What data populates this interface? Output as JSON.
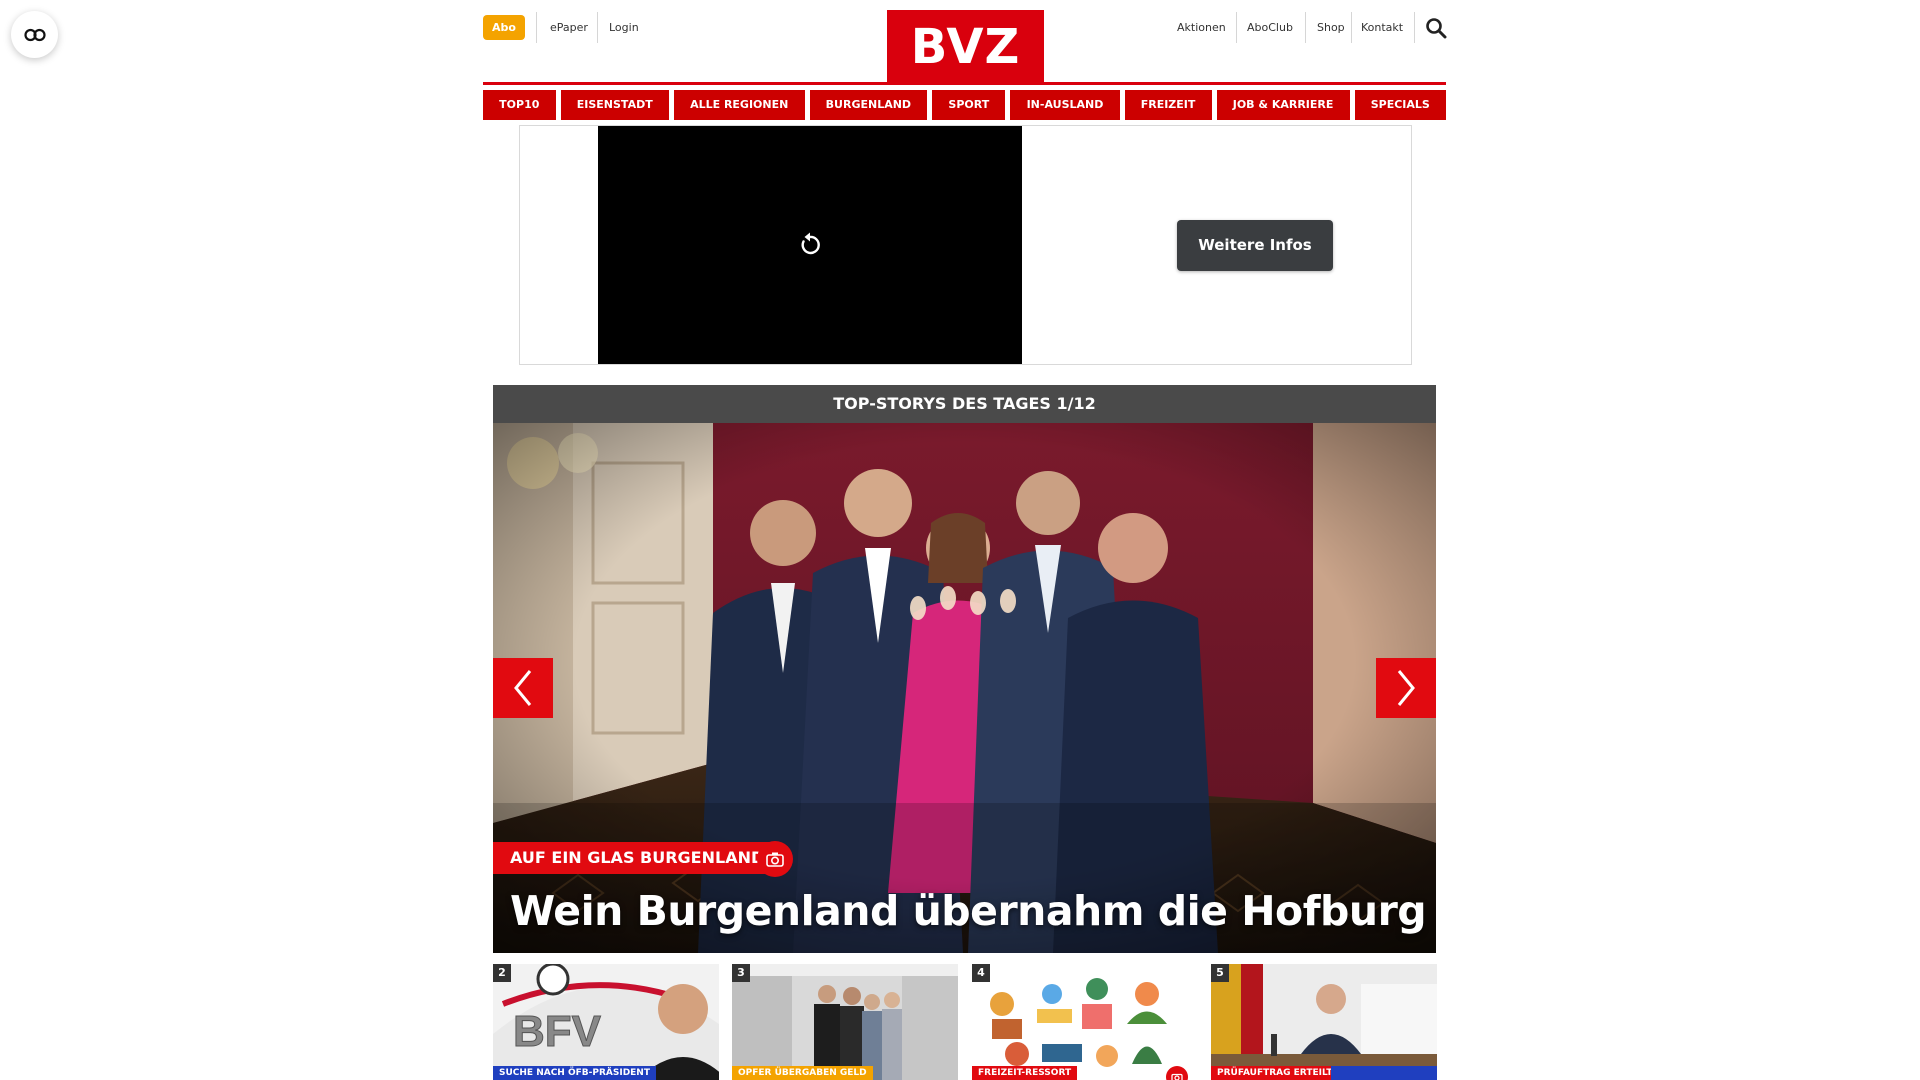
{
  "header": {
    "abo_label": "Abo",
    "epaper_label": "ePaper",
    "login_label": "Login",
    "logo_text": "BVZ",
    "right_links": [
      "Aktionen",
      "AboClub",
      "Shop",
      "Kontakt"
    ]
  },
  "nav": {
    "items": [
      "TOP10",
      "EISENSTADT",
      "ALLE REGIONEN",
      "BURGENLAND",
      "SPORT",
      "IN-AUSLAND",
      "FREIZEIT",
      "JOB & KARRIERE",
      "SPECIALS"
    ]
  },
  "ad": {
    "button_label": "Weitere Infos"
  },
  "top_stories": {
    "heading": "TOP-STORYS DES TAGES 1/12",
    "hero": {
      "kicker": "AUF EIN GLAS BURGENLAND",
      "headline": "Wein Burgenland übernahm die Hofburg"
    },
    "thumbs": [
      {
        "num": "2",
        "tag": "SUCHE NACH ÖFB-PRÄSIDENT",
        "image_text": "BFV"
      },
      {
        "num": "3",
        "tag": "OPFER ÜBERGABEN GELD"
      },
      {
        "num": "4",
        "tag": "FREIZEIT-RESSORT"
      },
      {
        "num": "5",
        "tag": "PRÜFAUFTRAG ERTEILT"
      }
    ]
  },
  "colors": {
    "brand_red": "#d9000d",
    "abo_yellow": "#f4a300",
    "thumb_tag_yellow": "#f4a300",
    "thumb_tag_blue": "#1f3fbf"
  },
  "icons": [
    "reader-mode-icon",
    "search-icon",
    "replay-icon",
    "chevron-left-icon",
    "chevron-right-icon",
    "camera-icon"
  ]
}
